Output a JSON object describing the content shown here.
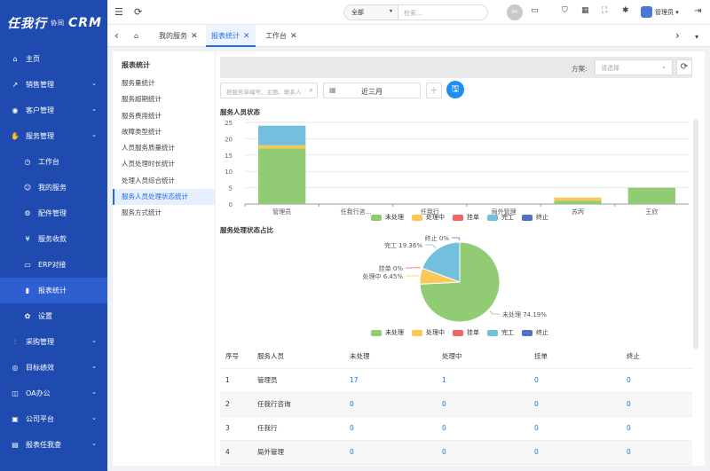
{
  "brand": {
    "logo_main": "任我行",
    "logo_sub": "协同",
    "logo_crm": "CRM"
  },
  "sidebar": {
    "items": [
      {
        "label": "主页",
        "icon": "home-icon",
        "caret": false,
        "sub": false,
        "active": false
      },
      {
        "label": "销售管理",
        "icon": "trend-icon",
        "caret": true,
        "sub": false,
        "active": false
      },
      {
        "label": "客户管理",
        "icon": "person-icon",
        "caret": true,
        "sub": false,
        "active": false
      },
      {
        "label": "服务管理",
        "icon": "thumb-icon",
        "caret": true,
        "sub": false,
        "active": false
      },
      {
        "label": "工作台",
        "icon": "clock-icon",
        "caret": false,
        "sub": true,
        "active": false
      },
      {
        "label": "我的服务",
        "icon": "face-icon",
        "caret": false,
        "sub": true,
        "active": false
      },
      {
        "label": "配件管理",
        "icon": "gear-icon",
        "caret": false,
        "sub": true,
        "active": false
      },
      {
        "label": "服务收款",
        "icon": "money-icon",
        "caret": false,
        "sub": true,
        "active": false
      },
      {
        "label": "ERP对接",
        "icon": "monitor-icon",
        "caret": false,
        "sub": true,
        "active": false
      },
      {
        "label": "报表统计",
        "icon": "bar-chart-icon",
        "caret": false,
        "sub": true,
        "active": true
      },
      {
        "label": "设置",
        "icon": "settings-icon",
        "caret": false,
        "sub": true,
        "active": false
      },
      {
        "label": "采购管理",
        "icon": "sliders-icon",
        "caret": true,
        "sub": false,
        "active": false
      },
      {
        "label": "目标绩效",
        "icon": "target-icon",
        "caret": true,
        "sub": false,
        "active": false
      },
      {
        "label": "OA办公",
        "icon": "oa-icon",
        "caret": true,
        "sub": false,
        "active": false
      },
      {
        "label": "公司平台",
        "icon": "screen-icon",
        "caret": true,
        "sub": false,
        "active": false
      },
      {
        "label": "报表任我查",
        "icon": "report-icon",
        "caret": true,
        "sub": false,
        "active": false
      }
    ]
  },
  "topbar": {
    "select_value": "全部",
    "search_placeholder": "检索...",
    "user_name": "管理员"
  },
  "tabs": [
    {
      "label": "我的服务"
    },
    {
      "label": "报表统计"
    },
    {
      "label": "工作台"
    }
  ],
  "leftnav": {
    "title": "报表统计",
    "items": [
      "服务量统计",
      "服务超期统计",
      "服务费用统计",
      "故障类型统计",
      "人员服务质量统计",
      "人员处理时长统计",
      "处理人员综合统计",
      "服务人员处理状态统计",
      "服务方式统计"
    ]
  },
  "filters": {
    "scheme_label": "方案:",
    "scheme_placeholder": "请选择",
    "keyword_placeholder": "按服务单编号、主题、联系人",
    "date_range": "近三月"
  },
  "colors": {
    "未处理": "#91cc75",
    "处理中": "#fac858",
    "挂单": "#ee6666",
    "完工": "#73c0de",
    "终止": "#5470c6"
  },
  "chart_data": [
    {
      "type": "bar",
      "title": "服务人员状态",
      "categories": [
        "管理员",
        "任我行咨...",
        "任我行",
        "局外管理",
        "苏丙",
        "王欣"
      ],
      "series": [
        {
          "name": "未处理",
          "values": [
            17,
            0,
            0,
            0,
            1,
            5
          ]
        },
        {
          "name": "处理中",
          "values": [
            1,
            0,
            0,
            0,
            1,
            0
          ]
        },
        {
          "name": "挂单",
          "values": [
            0,
            0,
            0,
            0,
            0,
            0
          ]
        },
        {
          "name": "完工",
          "values": [
            6,
            0,
            0,
            0,
            0,
            0
          ]
        },
        {
          "name": "终止",
          "values": [
            0,
            0,
            0,
            0,
            0,
            0
          ]
        }
      ],
      "stacked": true,
      "ylim": [
        0,
        25
      ],
      "yticks": [
        0,
        5,
        10,
        15,
        20,
        25
      ],
      "legend_position": "bottom-right"
    },
    {
      "type": "pie",
      "title": "服务处理状态占比",
      "slices": [
        {
          "name": "未处理",
          "value": 74.19,
          "label": "未处理 74.19%"
        },
        {
          "name": "处理中",
          "value": 6.45,
          "label": "处理中 6.45%"
        },
        {
          "name": "挂单",
          "value": 0,
          "label": "挂单 0%"
        },
        {
          "name": "完工",
          "value": 19.36,
          "label": "完工 19.36%"
        },
        {
          "name": "终止",
          "value": 0,
          "label": "终止 0%"
        }
      ],
      "legend_position": "bottom"
    }
  ],
  "table": {
    "headers": [
      "序号",
      "服务人员",
      "未处理",
      "处理中",
      "挂单",
      "终止"
    ],
    "rows": [
      [
        "1",
        "管理员",
        "17",
        "1",
        "0",
        "0"
      ],
      [
        "2",
        "任我行咨询",
        "0",
        "0",
        "0",
        "0"
      ],
      [
        "3",
        "任我行",
        "0",
        "0",
        "0",
        "0"
      ],
      [
        "4",
        "局外管理",
        "0",
        "0",
        "0",
        "0"
      ]
    ]
  }
}
